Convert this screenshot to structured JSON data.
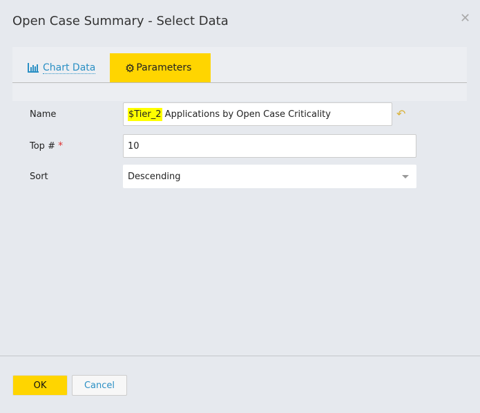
{
  "dialog": {
    "title": "Open Case Summary - Select Data",
    "close_icon": "close-icon"
  },
  "tabs": [
    {
      "label": "Chart Data",
      "icon": "bar-chart-icon"
    },
    {
      "label": "Parameters",
      "icon": "gears-icon",
      "active": true
    }
  ],
  "form": {
    "name": {
      "label": "Name",
      "token": "$Tier_2",
      "value": " Applications by Open Case Criticality",
      "revert_icon": "undo-icon"
    },
    "top": {
      "label": "Top #",
      "required": "*",
      "value": "10"
    },
    "sort": {
      "label": "Sort",
      "value": "Descending"
    }
  },
  "footer": {
    "ok": "OK",
    "cancel": "Cancel"
  },
  "colors": {
    "accent": "#ffd500",
    "link": "#2a8fc4",
    "highlight": "#ffff00"
  }
}
